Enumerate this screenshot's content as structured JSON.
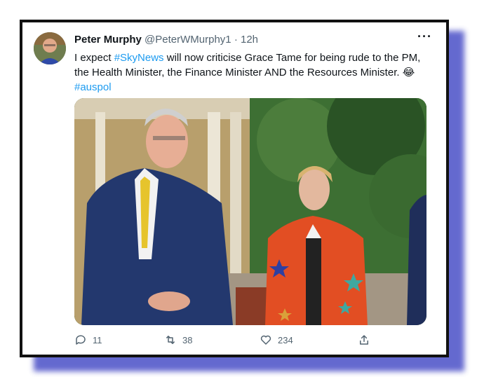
{
  "tweet": {
    "author_name": "Peter Murphy",
    "handle": "@PeterWMurphy1",
    "separator": "·",
    "time": "12h",
    "more_label": "···",
    "text_before": "I expect ",
    "hashtag_1": "#SkyNews",
    "text_after": " will now criticise Grace Tame for being rude to the PM, the Health Minister, the Finance Minister AND the Resources Minister. ",
    "emoji": "😂",
    "hashtag_2": "#auspol"
  },
  "actions": {
    "replies": "11",
    "retweets": "38",
    "likes": "234"
  },
  "icons": [
    "avatar",
    "more-icon",
    "reply-icon",
    "retweet-icon",
    "like-icon",
    "share-icon"
  ],
  "colors": {
    "link": "#1d9bf0",
    "frame_shadow": "#4a4fc7",
    "muted": "#536471"
  }
}
